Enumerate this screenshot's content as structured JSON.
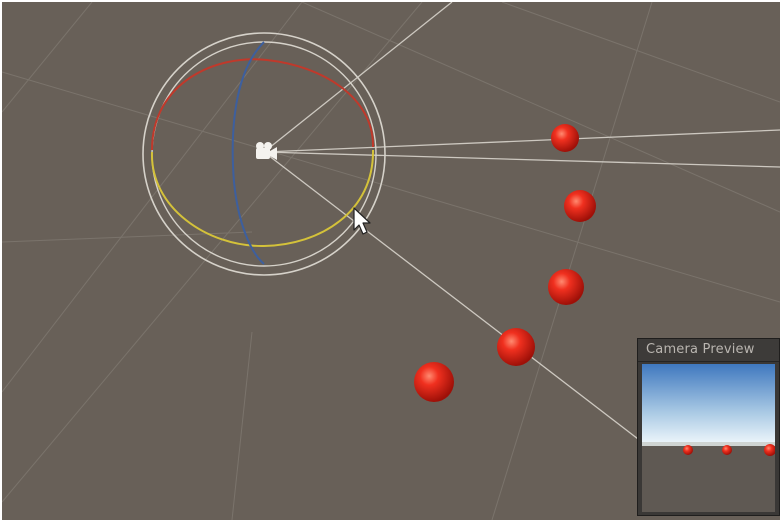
{
  "viewport": {
    "background_color": "#686058",
    "grid_color": "#8a847c",
    "ray_color": "#d8d4cc"
  },
  "gizmo": {
    "camera_icon": "camera-icon",
    "ring_x_color": "#c0392b",
    "ring_y_color": "#d4c23a",
    "ring_z_color": "#3d5f9e",
    "outer_ring_color": "#d6d2ca"
  },
  "spheres": {
    "color": "#e8201a",
    "count": 5
  },
  "cursor": {
    "icon": "mouse-pointer-icon"
  },
  "camera_preview": {
    "title": "Camera Preview",
    "sky_top_color": "#3f78bf",
    "sky_horizon_color": "#e8f2f8",
    "ground_color": "#5f5953",
    "sphere_count": 3
  }
}
